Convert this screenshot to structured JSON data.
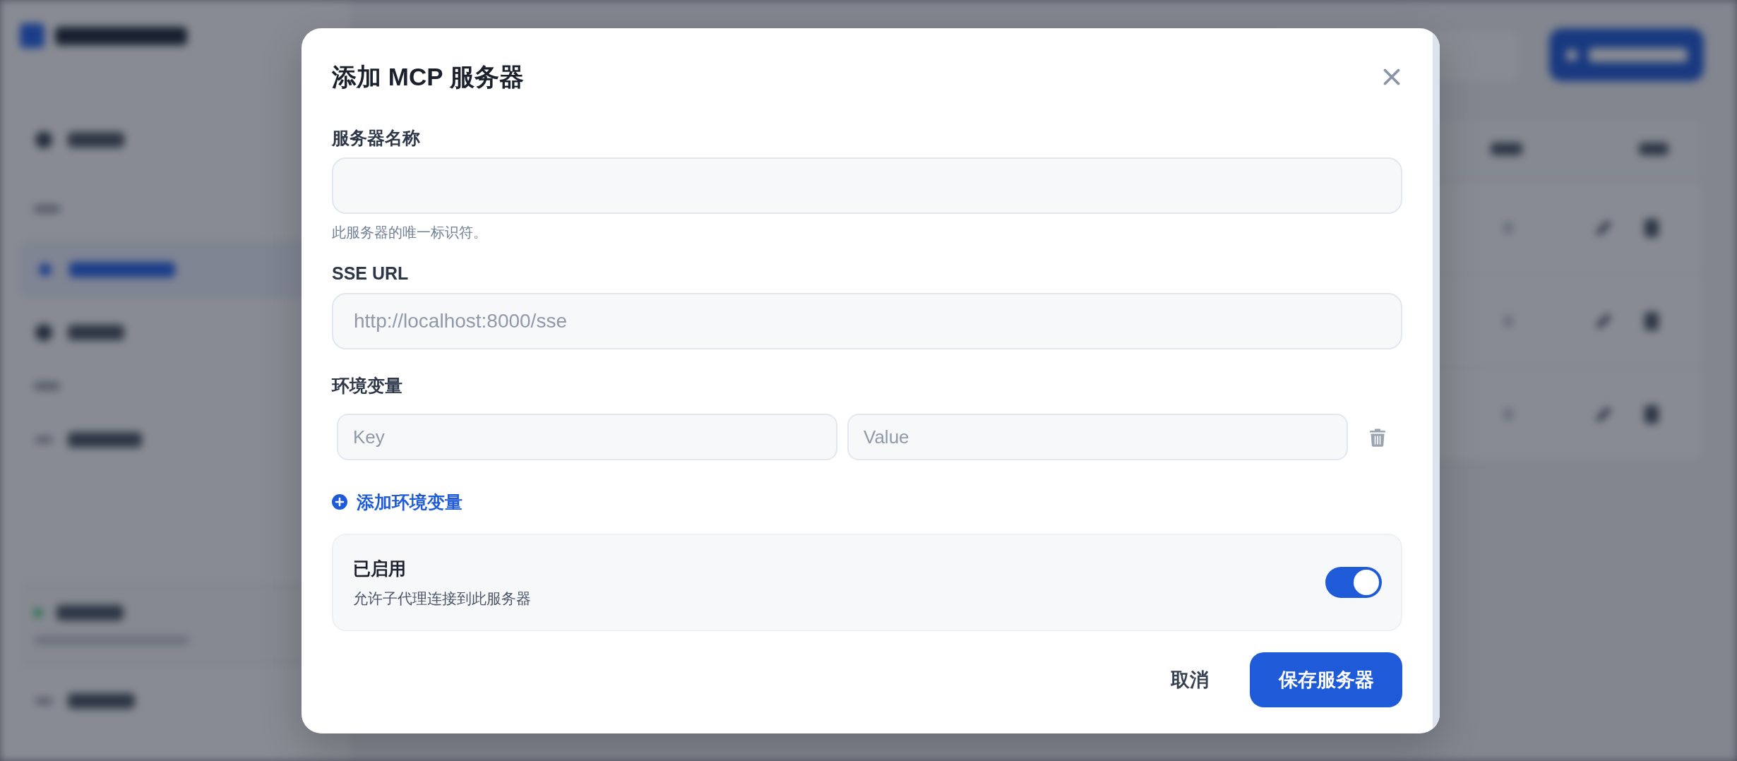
{
  "dialog": {
    "title": "添加 MCP 服务器"
  },
  "fields": [
    {
      "label": "服务器名称",
      "hint": "此服务器的唯一标识符。"
    },
    {
      "label": "SSE URL",
      "placeholder": "http://localhost:8000/sse"
    }
  ],
  "env": {
    "label": "环境变量",
    "rows": [
      {
        "key": {
          "placeholder": "Key"
        },
        "value": {
          "placeholder": "Value"
        }
      }
    ],
    "add_link": "添加环境变量"
  },
  "enabled": {
    "title": "已启用",
    "description": "允许子代理连接到此服务器",
    "on": true
  },
  "footer": {
    "cancel": "取消",
    "save": "保存服务器"
  }
}
